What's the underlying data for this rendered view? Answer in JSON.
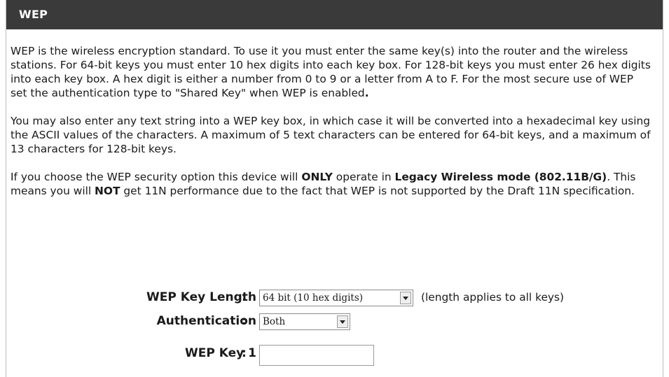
{
  "section": {
    "title": "WEP"
  },
  "paragraphs": {
    "p1_a": "WEP is the wireless encryption standard. To use it you must enter the same key(s) into the router and the wireless stations. For 64-bit keys you must enter 10 hex digits into each key box. For 128-bit keys you must enter 26 hex digits into each key box. A hex digit is either a number from 0 to 9 or a letter from A to F. For the most secure use of WEP set the authentication type to \"Shared Key\" when WEP is enabled",
    "p1_end": ".",
    "p2": "You may also enter any text string into a WEP key box, in which case it will be converted into a hexadecimal key using the ASCII values of the characters. A maximum of 5 text characters can be entered for 64-bit keys, and a maximum of 13 characters for 128-bit keys.",
    "p3_a": "If you choose the WEP security option this device will ",
    "p3_only": "ONLY",
    "p3_b": " operate in ",
    "p3_mode": "Legacy Wireless mode (802.11B/G)",
    "p3_c": ". This means you will ",
    "p3_not": "NOT",
    "p3_d": " get 11N performance due to the fact that WEP is not supported by the Draft 11N specification."
  },
  "form": {
    "colon": ":",
    "key_length": {
      "label": "WEP Key Length",
      "value": "64 bit (10 hex digits)",
      "hint": "(length applies to all keys)"
    },
    "authentication": {
      "label": "Authentication",
      "value": "Both"
    },
    "key1": {
      "label": "WEP Key 1",
      "value": ""
    }
  }
}
